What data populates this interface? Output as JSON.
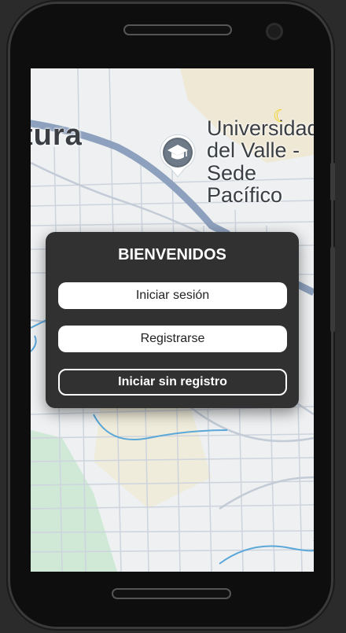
{
  "map": {
    "place_left": "tura",
    "place_university": "Universidad\ndel Valle -\nSede Pacífico",
    "marker_icon": "graduation-cap-icon",
    "theme_icon": "moon-icon",
    "colors": {
      "road": "#8da0bd",
      "water": "#5aa7d8",
      "park": "#cfe9d6",
      "sand": "#efe6cc"
    }
  },
  "dialog": {
    "title": "BIENVENIDOS",
    "login_label": "Iniciar sesión",
    "register_label": "Registrarse",
    "guest_label": "Iniciar sin registro"
  }
}
